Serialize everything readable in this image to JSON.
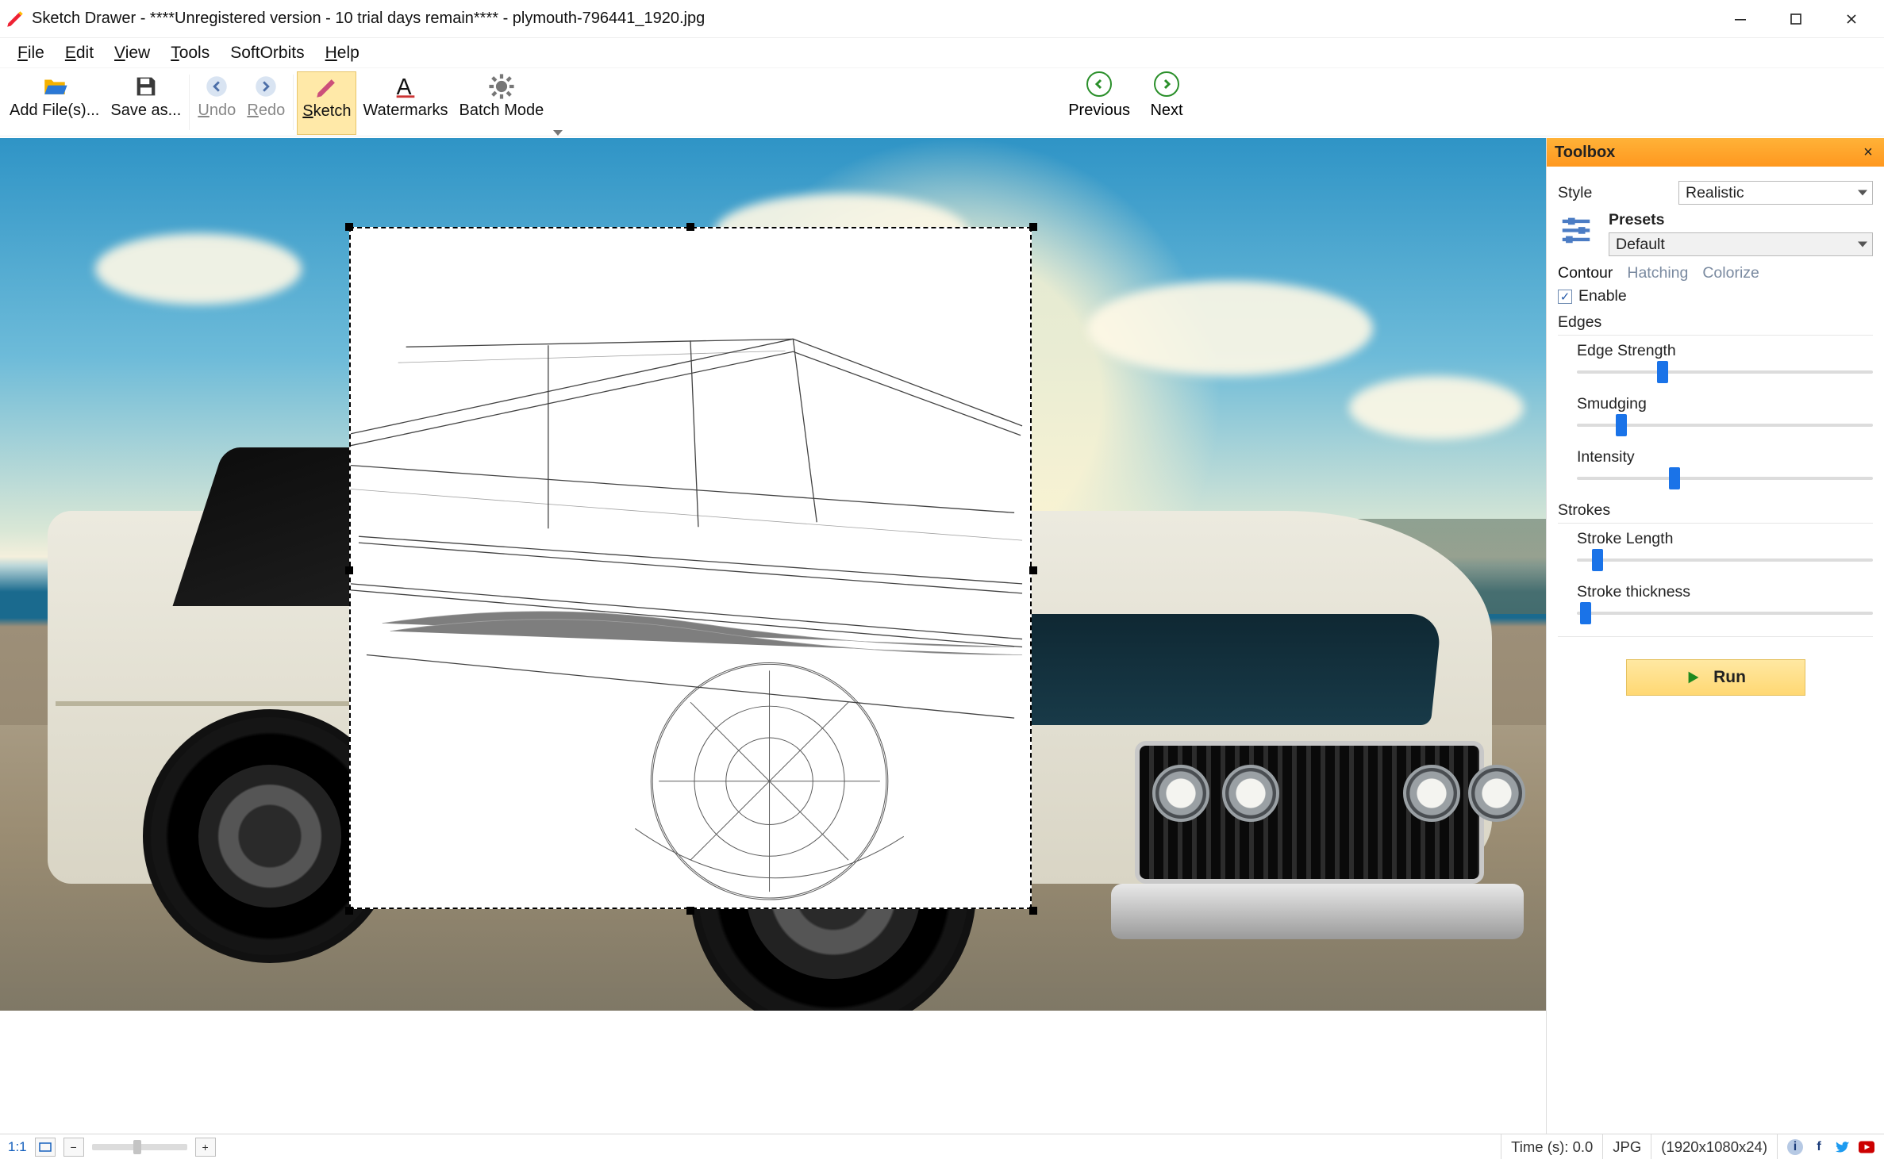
{
  "window": {
    "title": "Sketch Drawer - ****Unregistered version - 10 trial days remain**** - plymouth-796441_1920.jpg"
  },
  "menu": {
    "file": "File",
    "edit": "Edit",
    "view": "View",
    "tools": "Tools",
    "softorbits": "SoftOrbits",
    "help": "Help"
  },
  "toolbar": {
    "add": "Add File(s)...",
    "save": "Save as...",
    "undo": "Undo",
    "redo": "Redo",
    "sketch": "Sketch",
    "watermarks": "Watermarks",
    "batch": "Batch Mode",
    "previous": "Previous",
    "next": "Next"
  },
  "toolbox": {
    "title": "Toolbox",
    "style_label": "Style",
    "style_value": "Realistic",
    "presets_label": "Presets",
    "presets_value": "Default",
    "tab_contour": "Contour",
    "tab_hatching": "Hatching",
    "tab_colorize": "Colorize",
    "enable": "Enable",
    "edges_title": "Edges",
    "edge_strength": "Edge Strength",
    "smudging": "Smudging",
    "intensity": "Intensity",
    "strokes_title": "Strokes",
    "stroke_length": "Stroke Length",
    "stroke_thickness": "Stroke thickness",
    "run": "Run",
    "sliders": {
      "edge_strength": 29,
      "smudging": 15,
      "intensity": 33,
      "stroke_length": 7,
      "stroke_thickness": 3
    }
  },
  "status": {
    "zoom_label": "1:1",
    "time": "Time (s): 0.0",
    "format": "JPG",
    "dims": "(1920x1080x24)"
  }
}
